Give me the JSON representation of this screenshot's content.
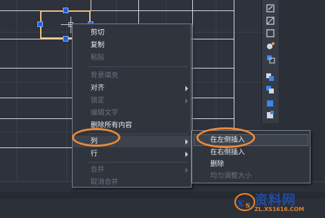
{
  "context_menu": {
    "items": [
      {
        "label": "剪切",
        "enabled": true,
        "submenu": false
      },
      {
        "label": "复制",
        "enabled": true,
        "submenu": false
      },
      {
        "label": "粘贴",
        "enabled": false,
        "submenu": false
      },
      {
        "label": "背景填充",
        "enabled": false,
        "submenu": false
      },
      {
        "label": "对齐",
        "enabled": true,
        "submenu": true
      },
      {
        "label": "锁定",
        "enabled": false,
        "submenu": true
      },
      {
        "label": "编辑文字",
        "enabled": false,
        "submenu": false
      },
      {
        "label": "删除所有内容",
        "enabled": true,
        "submenu": false
      },
      {
        "label": "列",
        "enabled": true,
        "submenu": true,
        "highlighted": true
      },
      {
        "label": "行",
        "enabled": true,
        "submenu": true
      },
      {
        "label": "合并",
        "enabled": false,
        "submenu": true
      },
      {
        "label": "取消合并",
        "enabled": false,
        "submenu": false
      }
    ]
  },
  "column_submenu": {
    "items": [
      {
        "label": "在左侧插入",
        "enabled": true,
        "highlighted": true
      },
      {
        "label": "在右侧插入",
        "enabled": true
      },
      {
        "label": "删除",
        "enabled": true
      },
      {
        "label": "均匀调整大小",
        "enabled": false
      }
    ]
  },
  "watermark": {
    "title": "资料网",
    "url": "ZL.XS1616.COM"
  },
  "colors": {
    "annotation_oval": "#e98a3b",
    "selection_border": "#f3c27a",
    "grip": "#1f5fdc"
  }
}
